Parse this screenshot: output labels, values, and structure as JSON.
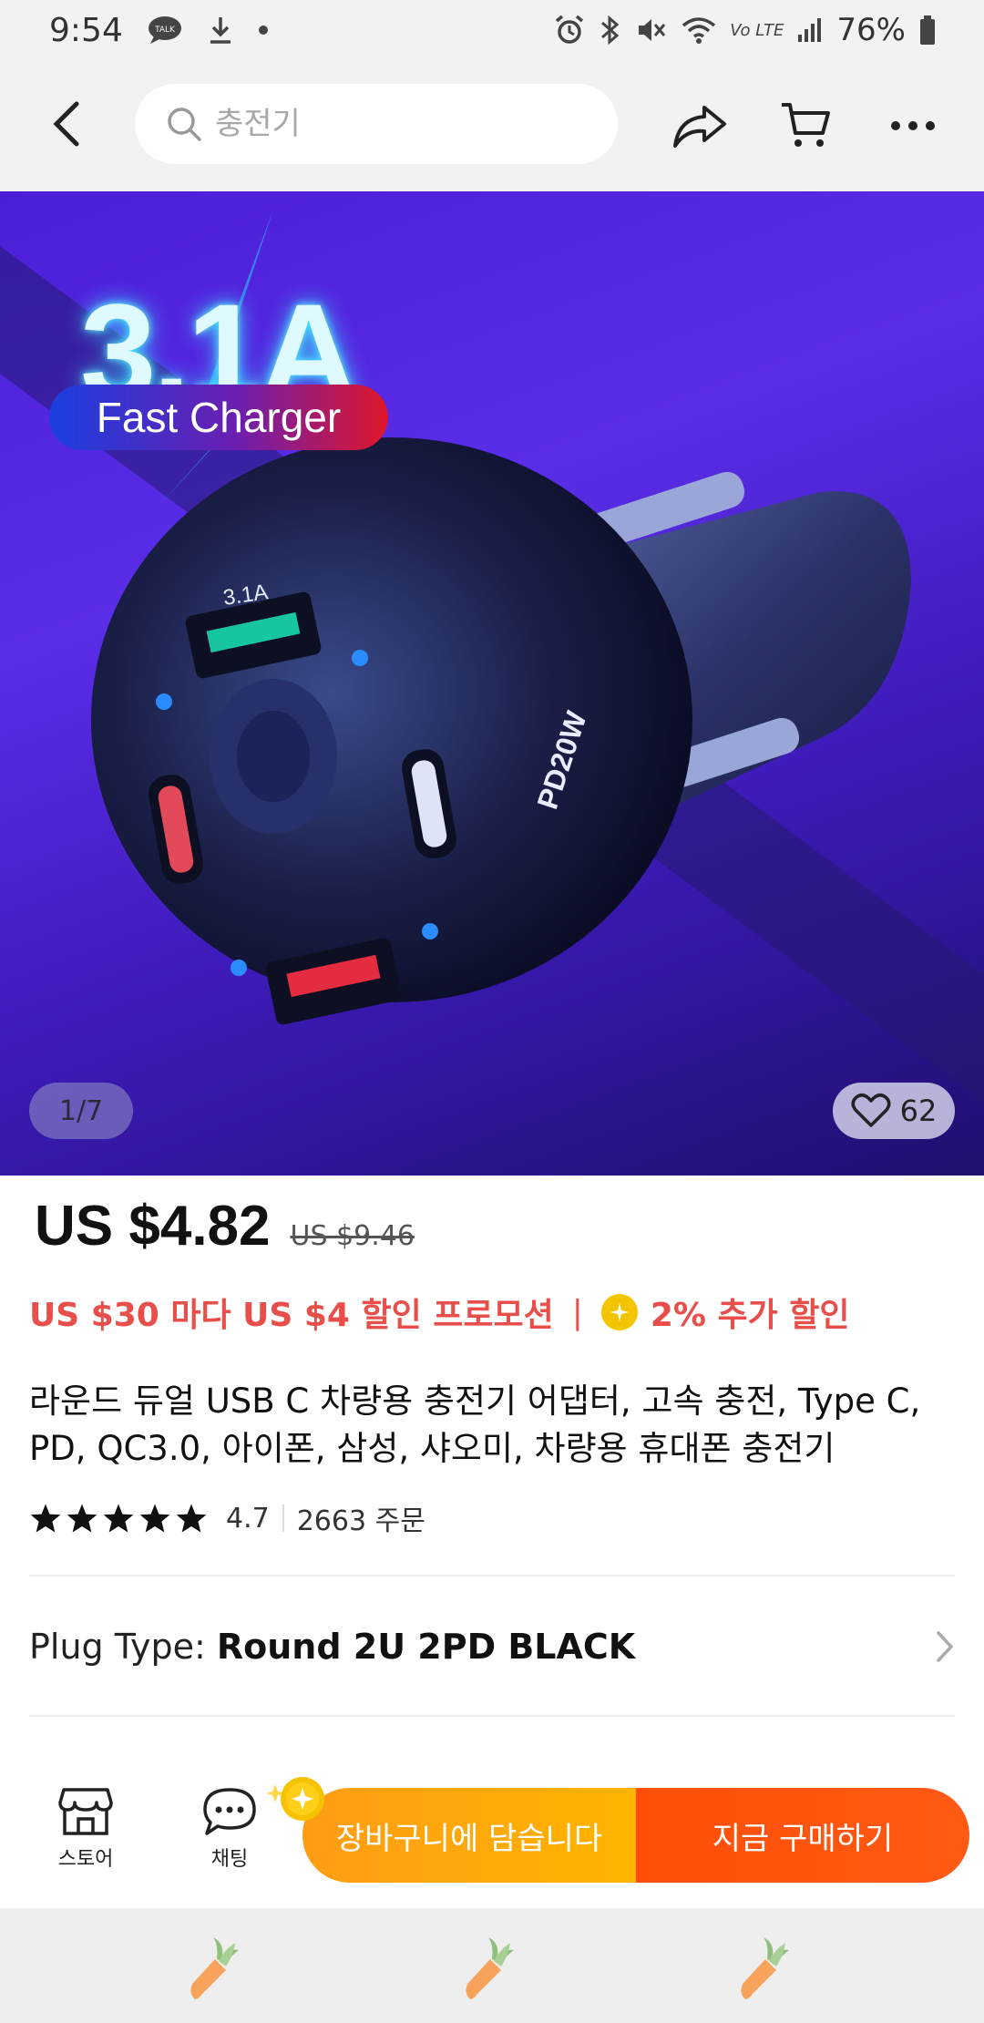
{
  "status_bar": {
    "time": "9:54",
    "battery": "76%",
    "lte_label": "Vo LTE"
  },
  "header": {
    "search_placeholder": "충전기"
  },
  "hero": {
    "title": "3.1A",
    "pill_text": "Fast Charger",
    "page_indicator": "1/7",
    "favorites_count": "62"
  },
  "price": {
    "current": "US $4.82",
    "original": "US $9.46"
  },
  "promo": {
    "deal_text": "US $30 마다 US $4 할인 프로모션",
    "separator": "|",
    "coin_text": "2% 추가 할인"
  },
  "product": {
    "title": "라운드 듀얼 USB C 차량용 충전기 어댑터, 고속 충전, Type C, PD, QC3.0, 아이폰, 삼성, 샤오미, 차량용 휴대폰 충전기",
    "rating": "4.7",
    "orders": "2663 주문",
    "star_count": 5
  },
  "variant": {
    "label": "Plug Type:",
    "value": "Round 2U 2PD BLACK"
  },
  "action_bar": {
    "store_label": "스토어",
    "chat_label": "채팅",
    "add_to_cart": "장바구니에 담습니다",
    "buy_now": "지금 구매하기"
  },
  "colors": {
    "accent_red": "#e84e4a",
    "cart_orange": "#ffa50a",
    "buy_orange": "#ff5010",
    "coin_yellow": "#f5c400"
  }
}
